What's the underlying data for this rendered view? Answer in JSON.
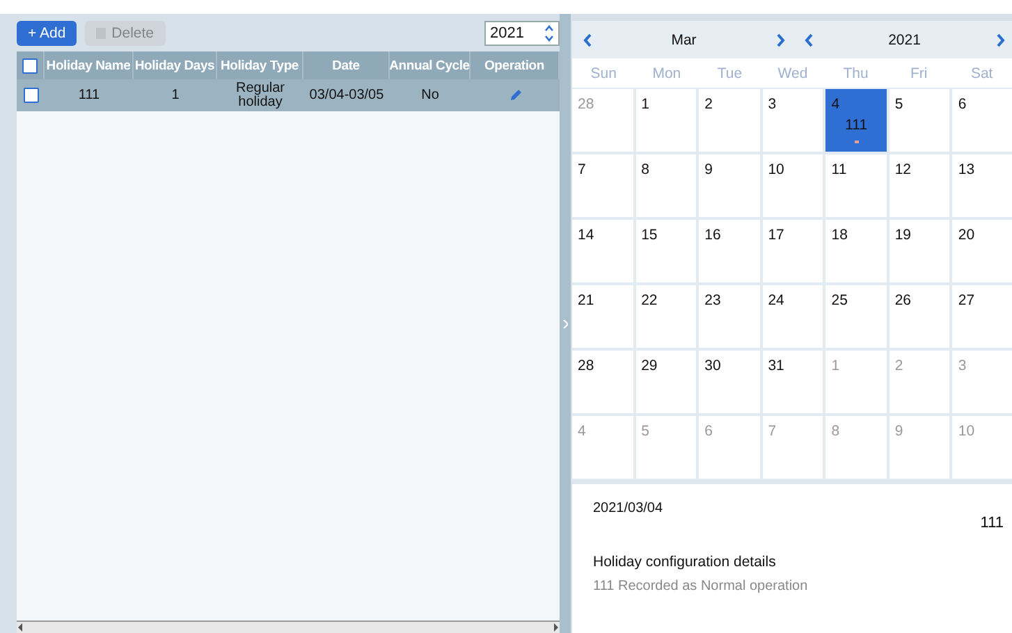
{
  "toolbar": {
    "add_button": {
      "label": "+ Add",
      "disabled": false
    },
    "delete_button": {
      "label": "Delete",
      "disabled": true
    },
    "year_field": {
      "value": "2021"
    }
  },
  "table": {
    "header_checkbox": {
      "checked": false
    },
    "columns": [
      "Holiday Name",
      "Holiday Days",
      "Holiday Type",
      "Date",
      "Annual Cycle",
      "Operation"
    ],
    "rows": [
      {
        "checked": false,
        "selected": true,
        "cells": [
          "111",
          "1",
          "Regular holiday",
          "03/04-03/05",
          "No"
        ]
      }
    ]
  },
  "calendar": {
    "month": "Mar",
    "year": "2021",
    "weekdays": [
      "Sun",
      "Mon",
      "Tue",
      "Wed",
      "Thu",
      "Fri",
      "Sat"
    ],
    "weeks": [
      [
        {
          "day": "28",
          "in_month": false,
          "selected": false
        },
        {
          "day": "1",
          "in_month": true,
          "selected": false
        },
        {
          "day": "2",
          "in_month": true,
          "selected": false
        },
        {
          "day": "3",
          "in_month": true,
          "selected": false
        },
        {
          "day": "4",
          "in_month": true,
          "selected": true,
          "event": "111"
        },
        {
          "day": "5",
          "in_month": true,
          "selected": false
        },
        {
          "day": "6",
          "in_month": true,
          "selected": false
        }
      ],
      [
        {
          "day": "7",
          "in_month": true,
          "selected": false
        },
        {
          "day": "8",
          "in_month": true,
          "selected": false
        },
        {
          "day": "9",
          "in_month": true,
          "selected": false
        },
        {
          "day": "10",
          "in_month": true,
          "selected": false
        },
        {
          "day": "11",
          "in_month": true,
          "selected": false
        },
        {
          "day": "12",
          "in_month": true,
          "selected": false
        },
        {
          "day": "13",
          "in_month": true,
          "selected": false
        }
      ],
      [
        {
          "day": "14",
          "in_month": true,
          "selected": false
        },
        {
          "day": "15",
          "in_month": true,
          "selected": false
        },
        {
          "day": "16",
          "in_month": true,
          "selected": false
        },
        {
          "day": "17",
          "in_month": true,
          "selected": false
        },
        {
          "day": "18",
          "in_month": true,
          "selected": false
        },
        {
          "day": "19",
          "in_month": true,
          "selected": false
        },
        {
          "day": "20",
          "in_month": true,
          "selected": false
        }
      ],
      [
        {
          "day": "21",
          "in_month": true,
          "selected": false
        },
        {
          "day": "22",
          "in_month": true,
          "selected": false
        },
        {
          "day": "23",
          "in_month": true,
          "selected": false
        },
        {
          "day": "24",
          "in_month": true,
          "selected": false
        },
        {
          "day": "25",
          "in_month": true,
          "selected": false
        },
        {
          "day": "26",
          "in_month": true,
          "selected": false
        },
        {
          "day": "27",
          "in_month": true,
          "selected": false
        }
      ],
      [
        {
          "day": "28",
          "in_month": true,
          "selected": false
        },
        {
          "day": "29",
          "in_month": true,
          "selected": false
        },
        {
          "day": "30",
          "in_month": true,
          "selected": false
        },
        {
          "day": "31",
          "in_month": true,
          "selected": false
        },
        {
          "day": "1",
          "in_month": false,
          "selected": false
        },
        {
          "day": "2",
          "in_month": false,
          "selected": false
        },
        {
          "day": "3",
          "in_month": false,
          "selected": false
        }
      ],
      [
        {
          "day": "4",
          "in_month": false,
          "selected": false
        },
        {
          "day": "5",
          "in_month": false,
          "selected": false
        },
        {
          "day": "6",
          "in_month": false,
          "selected": false
        },
        {
          "day": "7",
          "in_month": false,
          "selected": false
        },
        {
          "day": "8",
          "in_month": false,
          "selected": false
        },
        {
          "day": "9",
          "in_month": false,
          "selected": false
        },
        {
          "day": "10",
          "in_month": false,
          "selected": false
        }
      ]
    ]
  },
  "details": {
    "date": "2021/03/04",
    "name": "111",
    "heading": "Holiday configuration details",
    "text": "111 Recorded as Normal operation"
  }
}
